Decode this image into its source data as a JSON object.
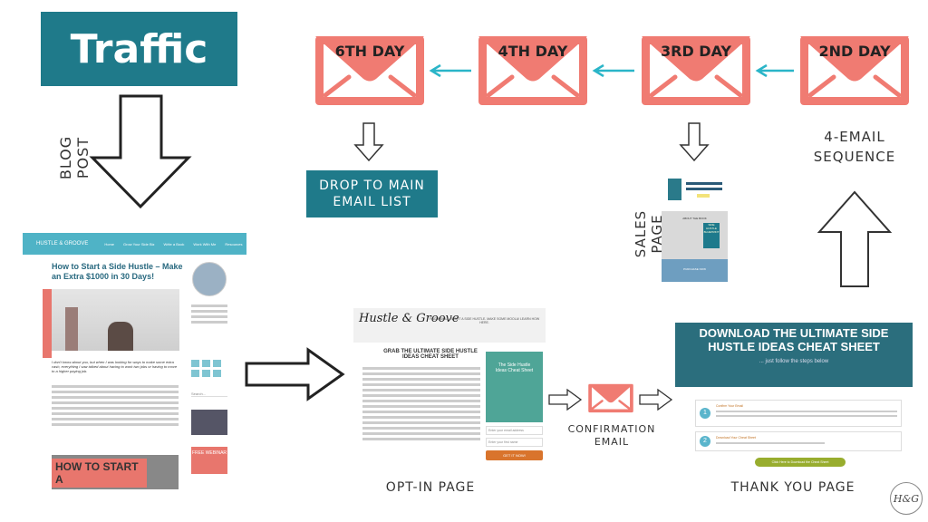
{
  "traffic": {
    "label": "Traffic"
  },
  "blog_post_label": "BLOG POST",
  "emails": [
    {
      "label": "6TH DAY"
    },
    {
      "label": "4TH DAY"
    },
    {
      "label": "3RD DAY"
    },
    {
      "label": "2ND DAY"
    }
  ],
  "sequence_label": "4-EMAIL SEQUENCE",
  "drop_box": {
    "label": "DROP TO MAIN EMAIL LIST"
  },
  "sales_page_label": "SALES PAGE",
  "sales_page": {
    "section": "ABOUT THE BOOK",
    "book": "SIDE HUSTLE BLUEPRINT",
    "button": "PURCHASE NOW"
  },
  "blog": {
    "logo": "HUSTLE & GROOVE",
    "nav": [
      "Home",
      "Grow Your Side Biz",
      "Write a Book",
      "Work With Me",
      "Resources"
    ],
    "title": "How to Start a Side Hustle – Make an Extra $1000 in 30 Days!",
    "intro": "I don't know about you, but when I was looking for ways to make some extra cash, everything I saw talked about having to work two jobs or having to move to a higher paying job.",
    "banner": "HOW TO START A",
    "search": "Search...",
    "webinar": "FREE WEBINAR"
  },
  "optin": {
    "logo": "Hustle & Groove",
    "tagline": "FIND A SKILL. START A SIDE HUSTLE. MAKE SOME MOOLA! LEARN HOW HERE.",
    "title": "GRAB THE ULTIMATE SIDE HUSTLE IDEAS CHEAT SHEET",
    "cover": "The Side Hustle Ideas Cheat Sheet",
    "email_placeholder": "Enter your email address",
    "name_placeholder": "Enter your first name",
    "button": "GET IT NOW!"
  },
  "optin_label": "OPT-IN PAGE",
  "confirmation_label": "CONFIRMATION EMAIL",
  "thankyou": {
    "title": "DOWNLOAD THE ULTIMATE SIDE HUSTLE IDEAS CHEAT SHEET",
    "subtitle": "... just follow the steps below",
    "steps": [
      {
        "num": "1",
        "title": "Confirm Your Email"
      },
      {
        "num": "2",
        "title": "Download Your Cheat Sheet"
      }
    ],
    "button": "Click Here to Download the Cheat Sheet"
  },
  "thankyou_label": "THANK YOU PAGE",
  "watermark": "H&G",
  "colors": {
    "teal": "#1f7a8a",
    "coral": "#f07b72",
    "arrow": "#2ab5c8"
  }
}
